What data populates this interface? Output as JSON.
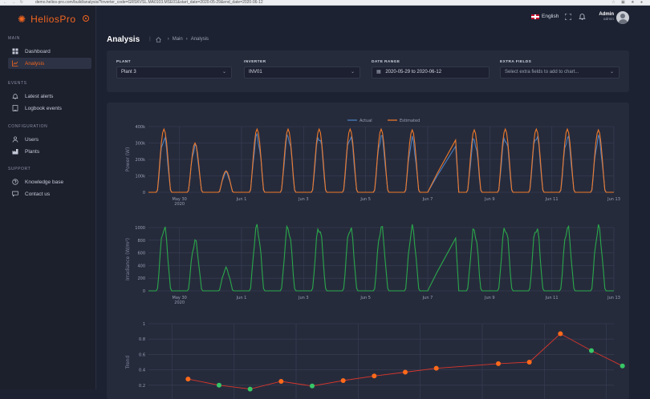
{
  "browser": {
    "url": "demo.helios-pro.com/build/analysis/?inverter_code=GRSKVSL.MA0103.MSE01&start_date=2020-05-29&end_date=2020-06-12"
  },
  "brand": {
    "name": "HeliosPro",
    "accent": "#f2661f"
  },
  "sidebar": {
    "sections": [
      {
        "title": "MAIN",
        "items": [
          {
            "label": "Dashboard",
            "icon": "dashboard-icon",
            "active": false
          },
          {
            "label": "Analysis",
            "icon": "chart-icon",
            "active": true
          }
        ]
      },
      {
        "title": "EVENTS",
        "items": [
          {
            "label": "Latest alerts",
            "icon": "bell-icon",
            "active": false
          },
          {
            "label": "Logbook events",
            "icon": "logbook-icon",
            "active": false
          }
        ]
      },
      {
        "title": "CONFIGURATION",
        "items": [
          {
            "label": "Users",
            "icon": "user-icon",
            "active": false
          },
          {
            "label": "Plants",
            "icon": "factory-icon",
            "active": false
          }
        ]
      },
      {
        "title": "SUPPORT",
        "items": [
          {
            "label": "Knowledge base",
            "icon": "help-icon",
            "active": false
          },
          {
            "label": "Contact us",
            "icon": "chat-icon",
            "active": false
          }
        ]
      }
    ]
  },
  "topbar": {
    "language": "English",
    "user_name": "Admin",
    "user_role": "admin"
  },
  "breadcrumb": {
    "title": "Analysis",
    "items": [
      "Main",
      "Analysis"
    ]
  },
  "filters": {
    "plant": {
      "label": "PLANT",
      "value": "Plant 3"
    },
    "inverter": {
      "label": "INVERTER",
      "value": "INV01"
    },
    "date_range": {
      "label": "DATE RANGE",
      "value": "2020-05-29 to 2020-06-12"
    },
    "extra": {
      "label": "EXTRA FIELDS",
      "placeholder": "Select extra fields to add to chart..."
    }
  },
  "chart_data": [
    {
      "type": "line",
      "ylabel": "Power (W)",
      "ylim": [
        0,
        400000
      ],
      "yticks": [
        "0",
        "100k",
        "200k",
        "300k",
        "400k"
      ],
      "x_tick_labels": [
        "May 30",
        "Jun 1",
        "Jun 3",
        "Jun 5",
        "Jun 7",
        "Jun 9",
        "Jun 11",
        "Jun 13"
      ],
      "x_year_label": "2020",
      "legend_position": "top-center",
      "grid": true,
      "series": [
        {
          "name": "Actual",
          "color": "#4a7fc0",
          "daily_peak_w": [
            330000,
            280000,
            120000,
            340000,
            345000,
            340000,
            340000,
            340000,
            320000,
            330000,
            320000,
            330000,
            345000,
            335000,
            330000
          ]
        },
        {
          "name": "Estimated",
          "color": "#f07a2a",
          "daily_peak_w": [
            385000,
            300000,
            130000,
            385000,
            385000,
            385000,
            385000,
            385000,
            380000,
            375000,
            380000,
            385000,
            385000,
            385000,
            380000
          ]
        }
      ]
    },
    {
      "type": "line",
      "ylabel": "Irradiance (W/m²)",
      "ylim": [
        0,
        1000
      ],
      "yticks": [
        "0",
        "200",
        "400",
        "600",
        "800",
        "1000"
      ],
      "x_tick_labels": [
        "May 30",
        "Jun 1",
        "Jun 3",
        "Jun 5",
        "Jun 7",
        "Jun 9",
        "Jun 11",
        "Jun 13"
      ],
      "x_year_label": "2020",
      "grid": true,
      "series": [
        {
          "color": "#2aa84a",
          "daily_peak": [
            1000,
            780,
            350,
            1000,
            1000,
            1000,
            1000,
            1000,
            980,
            980,
            960,
            1000,
            1000,
            1000,
            990
          ]
        }
      ]
    },
    {
      "type": "line",
      "ylabel": "Trend",
      "ylim": [
        0,
        1
      ],
      "yticks": [
        "0.2",
        "0.4",
        "0.6",
        "0.8",
        "1"
      ],
      "grid": true,
      "series": [
        {
          "color": "#d9362b",
          "values": [
            0.28,
            0.2,
            0.15,
            0.25,
            0.19,
            0.26,
            0.32,
            0.37,
            0.42,
            null,
            0.48,
            0.5,
            0.87,
            0.65,
            0.45
          ]
        }
      ],
      "point_colors": [
        "#ff6a1a",
        "#37c767",
        "#37c767",
        "#ff6a1a",
        "#37c767",
        "#ff6a1a",
        "#ff6a1a",
        "#ff6a1a",
        "#ff6a1a",
        null,
        "#ff6a1a",
        "#ff6a1a",
        "#ff6a1a",
        "#37c767",
        "#37c767"
      ]
    }
  ]
}
